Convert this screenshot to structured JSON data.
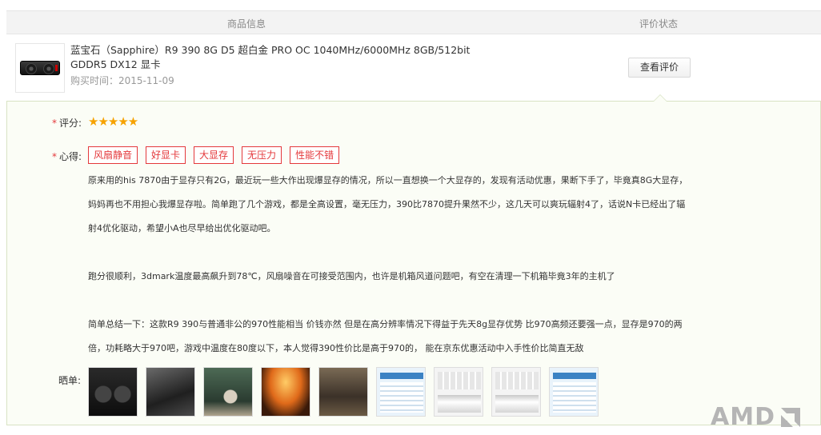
{
  "table_header": {
    "goods_info": "商品信息",
    "review_status": "评价状态"
  },
  "product": {
    "title": "蓝宝石（Sapphire）R9 390 8G D5 超白金 PRO OC 1040MHz/6000MHz 8GB/512bit GDDR5 DX12 显卡",
    "buy_time_label": "购买时间：",
    "buy_time": "2015-11-09",
    "view_review_button": "查看评价"
  },
  "review": {
    "rating_label": "评分:",
    "rating_value": 5,
    "stars": "★★★★★",
    "heart_label": "心得:",
    "tags": [
      "风扇静音",
      "好显卡",
      "大显存",
      "无压力",
      "性能不错"
    ],
    "comment_paragraphs": [
      "原来用的his 7870由于显存只有2G，最近玩一些大作出现爆显存的情况，所以一直想换一个大显存的，发现有活动优惠，果断下手了，毕竟真8G大显存，妈妈再也不用担心我爆显存啦。简单跑了几个游戏，都是全高设置，毫无压力，390比7870提升果然不少，这几天可以爽玩辐射4了，话说N卡已经出了辐射4优化驱动，希望小A也尽早给出优化驱动吧。",
      "跑分很顺利，3dmark温度最高飙升到78℃，风扇噪音在可接受范围内，也许是机箱风道问题吧，有空在清理一下机箱毕竟3年的主机了",
      "简单总结一下：这款R9 390与普通非公的970性能相当 价钱亦然 但是在高分辨率情况下得益于先天8g显存优势 比970高频还要强一点，显存是970的两倍，功耗略大于970吧，游戏中温度在80度以下，本人觉得390性价比是高于970的， 能在京东优惠活动中入手性价比简直无敌"
    ],
    "photos_label": "晒单:"
  },
  "watermark": {
    "logo_text": "AMD"
  },
  "colors": {
    "accent_red": "#e4393c",
    "star": "#f6a200",
    "panel_bg": "#fbfdf6",
    "panel_border": "#d8e3c4"
  }
}
